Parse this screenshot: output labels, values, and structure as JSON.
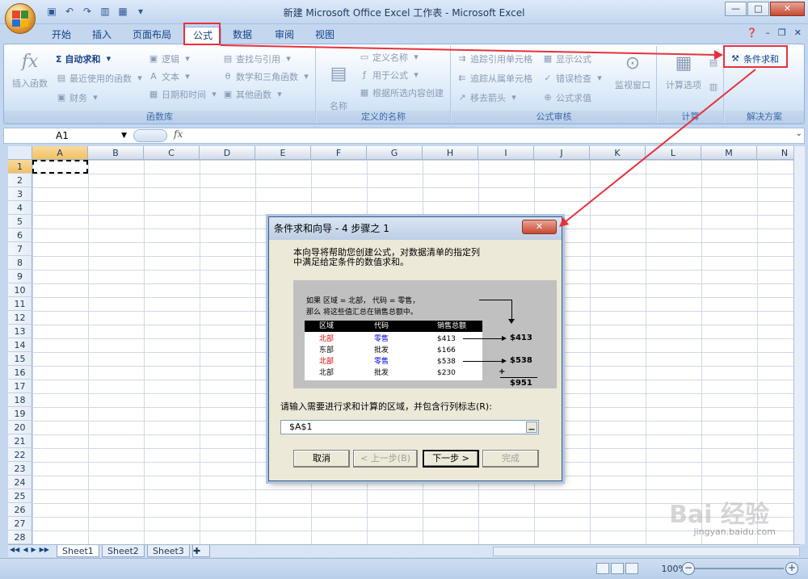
{
  "window": {
    "title": "新建 Microsoft Office Excel 工作表 - Microsoft Excel",
    "min_label": "—",
    "max_label": "□",
    "close_label": "✕"
  },
  "ribbon_tabs": [
    "开始",
    "插入",
    "页面布局",
    "公式",
    "数据",
    "审阅",
    "视图"
  ],
  "ribbon_tab_active": "公式",
  "groups": {
    "function_library": {
      "label": "函数库",
      "insert_function": "插入函数",
      "autosum": "Σ 自动求和",
      "recent": "最近使用的函数",
      "financial": "财务",
      "logical": "逻辑",
      "text": "文本",
      "datetime": "日期和时间",
      "lookup": "查找与引用",
      "math": "数学和三角函数",
      "more": "其他函数"
    },
    "defined_names": {
      "label": "定义的名称",
      "name_manager": "名称\n管理器",
      "define_name": "定义名称",
      "use_in_formula": "用于公式",
      "create_from_selection": "根据所选内容创建"
    },
    "formula_auditing": {
      "label": "公式审核",
      "trace_precedents": "追踪引用单元格",
      "trace_dependents": "追踪从属单元格",
      "remove_arrows": "移去箭头",
      "show_formulas": "显示公式",
      "error_checking": "错误检查",
      "evaluate": "公式求值",
      "watch": "监视窗口"
    },
    "calculation": {
      "label": "计算",
      "options": "计算选项"
    },
    "solutions": {
      "label": "解决方案",
      "conditional_sum": "条件求和"
    }
  },
  "formula_bar": {
    "name_box": "A1",
    "fx": "fx",
    "value": ""
  },
  "columns": [
    "A",
    "B",
    "C",
    "D",
    "E",
    "F",
    "G",
    "H",
    "I",
    "J",
    "K",
    "L",
    "M",
    "N"
  ],
  "rows": [
    "1",
    "2",
    "3",
    "4",
    "5",
    "6",
    "7",
    "8",
    "9",
    "10",
    "11",
    "12",
    "13",
    "14",
    "15",
    "16",
    "17",
    "18",
    "19",
    "20",
    "21",
    "22",
    "23",
    "24",
    "25",
    "26",
    "27",
    "28"
  ],
  "sheet_tabs": [
    "Sheet1",
    "Sheet2",
    "Sheet3"
  ],
  "status": {
    "zoom": "100%"
  },
  "dialog": {
    "title": "条件求和向导 - 4 步骤之 1",
    "close_label": "✕",
    "intro_line1": "本向导将帮助您创建公式，对数据清单的指定列",
    "intro_line2": "中满足给定条件的数值求和。",
    "illus_line1": "如果 区域 = 北部， 代码 = 零售，",
    "illus_line2": "那么 将这些值汇总在销售总额中。",
    "table_header": [
      "区域",
      "代码",
      "销售总额"
    ],
    "table_rows": [
      [
        "北部",
        "零售",
        "$413"
      ],
      [
        "东部",
        "批发",
        "$166"
      ],
      [
        "北部",
        "零售",
        "$538"
      ],
      [
        "北部",
        "批发",
        "$230"
      ]
    ],
    "result1": "$413",
    "result2": "$538",
    "plus": "+",
    "total": "$951",
    "prompt": "请输入需要进行求和计算的区域，并包含行列标志(R):",
    "range_value": "$A$1",
    "btn_cancel": "取消",
    "btn_back": "< 上一步(B)",
    "btn_next": "下一步 >",
    "btn_finish": "完成"
  },
  "watermark": {
    "brand": "Bai 经验",
    "url": "jingyan.baidu.com"
  },
  "colors": {
    "highlight_red": "#e8313b",
    "accent_blue": "#15428b",
    "table_red_text": "#e00000",
    "table_blue_text": "#0000e0"
  }
}
